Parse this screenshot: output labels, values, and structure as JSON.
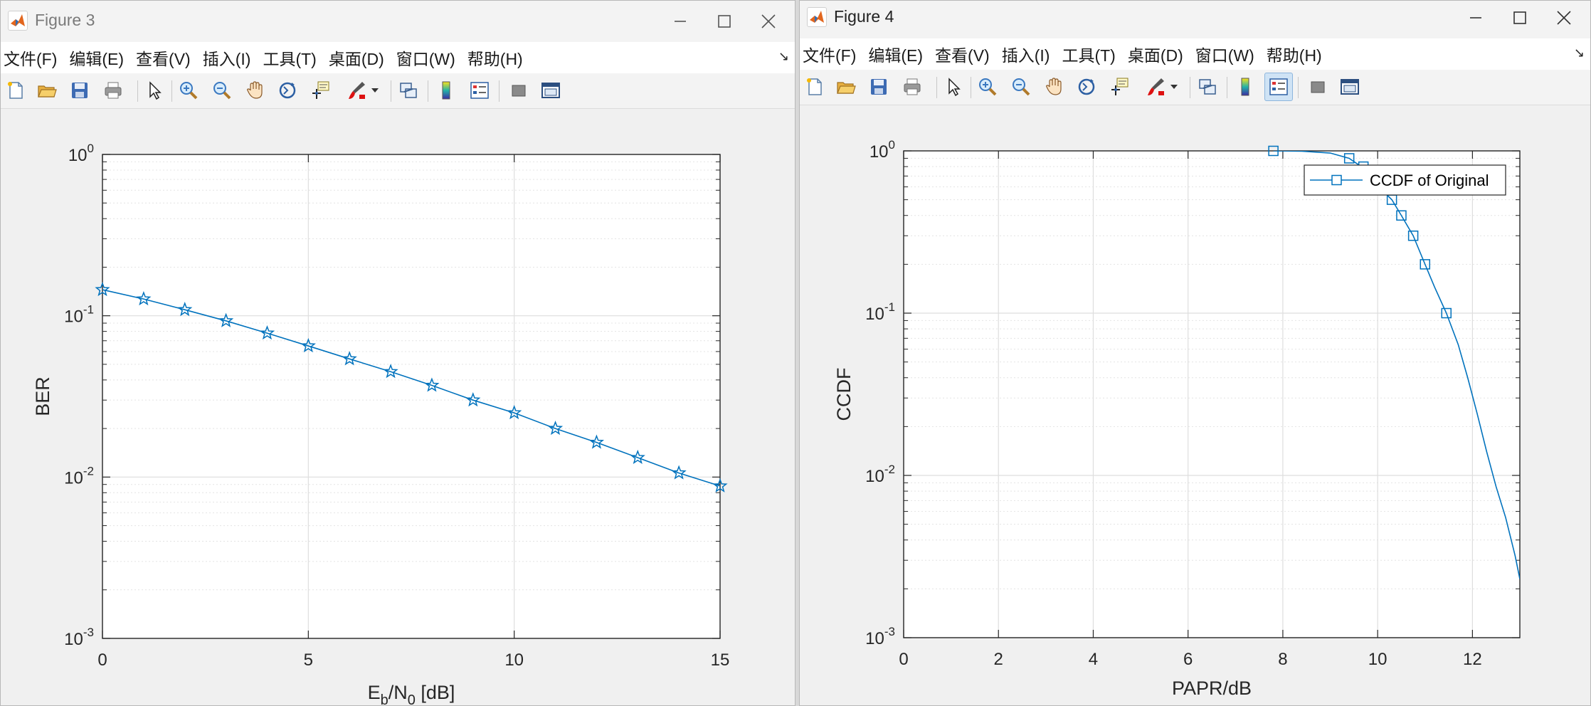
{
  "windows": [
    {
      "title": "Figure 3",
      "menu": [
        "文件(F)",
        "编辑(E)",
        "查看(V)",
        "插入(I)",
        "工具(T)",
        "桌面(D)",
        "窗口(W)",
        "帮助(H)"
      ],
      "chart_data": {
        "type": "line",
        "x": [
          0,
          1,
          2,
          3,
          4,
          5,
          6,
          7,
          8,
          9,
          10,
          11,
          12,
          13,
          14,
          15
        ],
        "series": [
          {
            "values": [
              0.145,
              0.127,
              0.109,
              0.093,
              0.078,
              0.065,
              0.054,
              0.045,
              0.037,
              0.03,
              0.025,
              0.02,
              0.0164,
              0.0132,
              0.0106,
              0.0088
            ],
            "marker": "pentagram",
            "color": "#0072BD"
          }
        ],
        "xlim": [
          0,
          15
        ],
        "ylim": [
          0.001,
          1
        ],
        "yscale": "log",
        "xticks": [
          "0",
          "5",
          "10",
          "15"
        ],
        "ylabel": "BER",
        "xlabel": {
          "main": "E",
          "sub1": "b",
          "mid": "/N",
          "sub2": "0",
          "tail": " [dB]"
        },
        "grid": true
      }
    },
    {
      "title": "Figure 4",
      "menu": [
        "文件(F)",
        "编辑(E)",
        "查看(V)",
        "插入(I)",
        "工具(T)",
        "桌面(D)",
        "窗口(W)",
        "帮助(H)"
      ],
      "chart_data": {
        "type": "line",
        "series": [
          {
            "name": "CCDF of Original",
            "marker": "square",
            "color": "#0072BD",
            "x": [
              7.8,
              8.4,
              9.0,
              9.4,
              9.6,
              9.8,
              10.0,
              10.3,
              10.5,
              10.75,
              11.0,
              11.2,
              11.45,
              11.7,
              11.9,
              12.1,
              12.3,
              12.5,
              12.7,
              12.8,
              12.9,
              13.0
            ],
            "y": [
              1.0,
              0.995,
              0.97,
              0.9,
              0.82,
              0.72,
              0.61,
              0.5,
              0.4,
              0.3,
              0.2,
              0.145,
              0.1,
              0.064,
              0.04,
              0.024,
              0.014,
              0.0085,
              0.0055,
              0.0042,
              0.0032,
              0.0023
            ],
            "marker_x": [
              7.8,
              9.4,
              9.7,
              10.3,
              10.5,
              10.75,
              11.0,
              11.45
            ],
            "marker_y": [
              1.0,
              0.9,
              0.8,
              0.5,
              0.4,
              0.3,
              0.2,
              0.1
            ]
          }
        ],
        "xlim": [
          0,
          13
        ],
        "ylim": [
          0.001,
          1
        ],
        "yscale": "log",
        "xticks": [
          "0",
          "2",
          "4",
          "6",
          "8",
          "10",
          "12"
        ],
        "ylabel": "CCDF",
        "xlabel": "PAPR/dB",
        "legend": "top-right",
        "grid": true
      }
    }
  ]
}
